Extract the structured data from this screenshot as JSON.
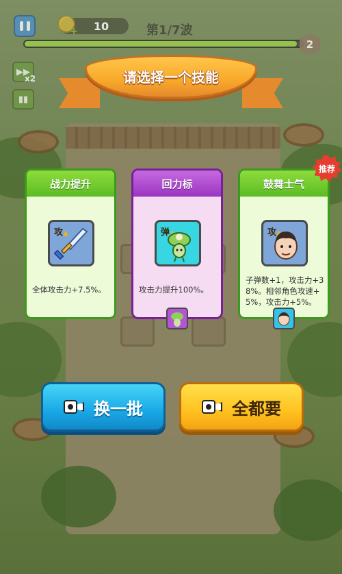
{
  "hud": {
    "coins": "10",
    "wave_label": "第1/7波",
    "wave_progress": 0.98,
    "wave_badge": "2",
    "speed_label": "x2"
  },
  "dialog": {
    "title": "请选择一个技能",
    "recommend_badge": "推荐"
  },
  "skills": [
    {
      "name": "战力提升",
      "tag": "攻",
      "icon": "sword-icon",
      "description": "全体攻击力+7.5%。"
    },
    {
      "name": "回力标",
      "tag": "弹",
      "icon": "plant-creature-icon",
      "description": "攻击力提升100%。"
    },
    {
      "name": "鼓舞士气",
      "tag": "攻",
      "icon": "boy-face-icon",
      "description": "子弹数+1，攻击力+38%。相邻角色攻速+5%，攻击力+5%。"
    }
  ],
  "actions": {
    "refresh_label": "换一批",
    "take_all_label": "全都要"
  },
  "colors": {
    "green_card": "#5cbc24",
    "purple_card": "#9b35c2",
    "refresh_button": "#19a8e6",
    "take_all_button": "#ffc21f",
    "ribbon": "#f8a92a"
  }
}
